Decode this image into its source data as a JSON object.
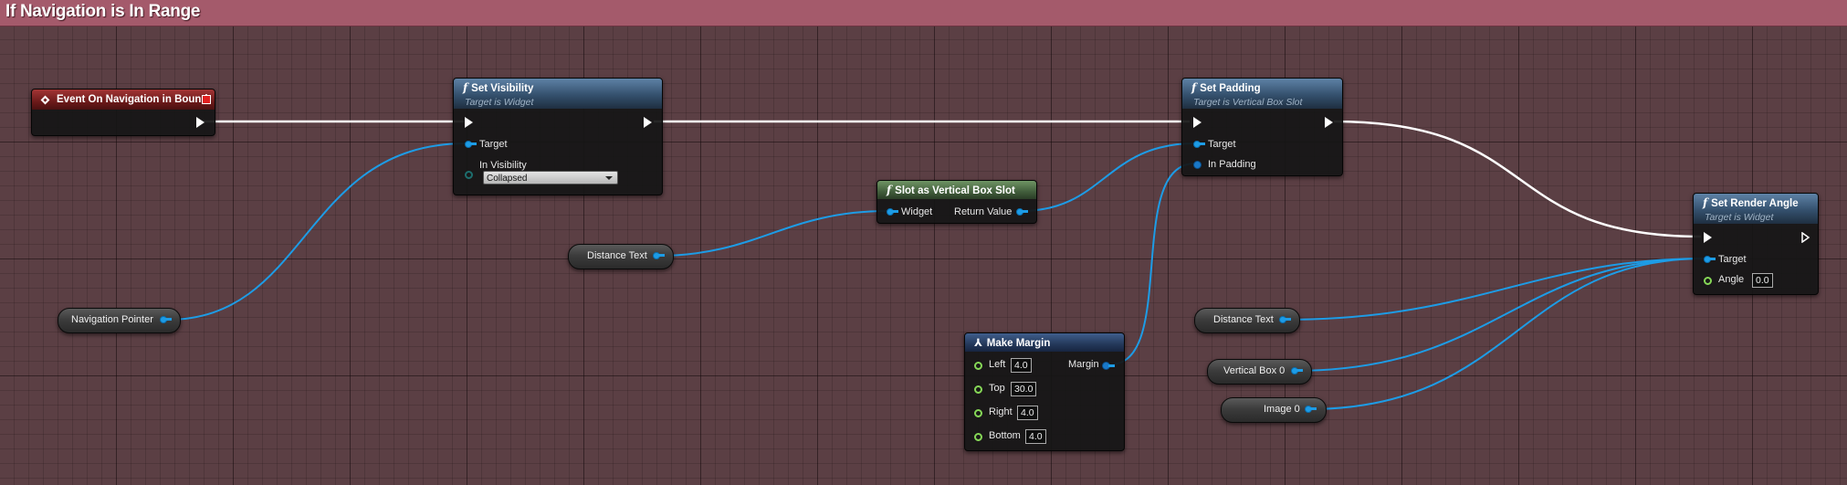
{
  "graph": {
    "title": "If Navigation is In Range"
  },
  "nodes": {
    "event": {
      "title": "Event On Navigation in Bound"
    },
    "set_visibility": {
      "title": "Set Visibility",
      "subtitle": "Target is Widget",
      "pin_target": "Target",
      "pin_in_visibility": "In Visibility",
      "visibility_value": "Collapsed"
    },
    "slot_as_vbox": {
      "title": "Slot as Vertical Box Slot",
      "pin_widget": "Widget",
      "pin_return": "Return Value"
    },
    "set_padding": {
      "title": "Set Padding",
      "subtitle": "Target is Vertical Box Slot",
      "pin_target": "Target",
      "pin_in_padding": "In Padding"
    },
    "make_margin": {
      "title": "Make Margin",
      "pin_margin": "Margin",
      "left_label": "Left",
      "left_value": "4.0",
      "top_label": "Top",
      "top_value": "30.0",
      "right_label": "Right",
      "right_value": "4.0",
      "bottom_label": "Bottom",
      "bottom_value": "4.0"
    },
    "set_render_angle": {
      "title": "Set Render Angle",
      "subtitle": "Target is Widget",
      "pin_target": "Target",
      "pin_angle": "Angle",
      "angle_value": "0.0"
    }
  },
  "variables": {
    "navigation_pointer": "Navigation Pointer",
    "distance_text_1": "Distance Text",
    "distance_text_2": "Distance Text",
    "vertical_box_0": "Vertical Box 0",
    "image_0": "Image 0"
  },
  "colors": {
    "background": "#5b3f44",
    "header": "#a45a6b",
    "object_pin": "#1d9ce6",
    "float_pin": "#86d857",
    "exec_wire": "#ffffff"
  }
}
